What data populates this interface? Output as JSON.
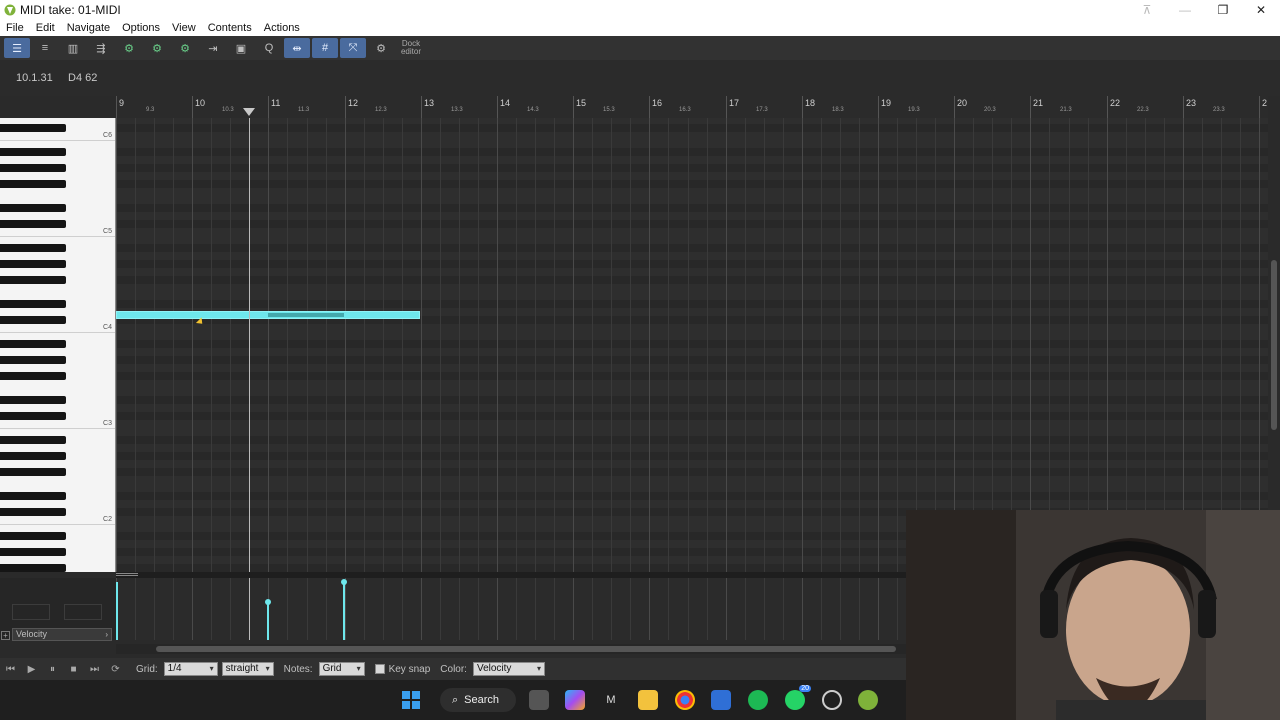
{
  "window": {
    "title": "MIDI take: 01-MIDI"
  },
  "menu": {
    "items": [
      "File",
      "Edit",
      "Navigate",
      "Options",
      "View",
      "Contents",
      "Actions"
    ]
  },
  "toolbar": {
    "dock_label_1": "Dock",
    "dock_label_2": "editor",
    "icons": [
      "midi-editor-icon",
      "list-view-icon",
      "notation-icon",
      "event-properties-icon",
      "step-input-icon",
      "snap-icon",
      "quantize-icon",
      "grid-icon",
      "piano-roll-icon",
      "dock-icon"
    ]
  },
  "info": {
    "position": "10.1.31",
    "note": "D4 62"
  },
  "ruler": {
    "bars": [
      "9",
      "10",
      "11",
      "12",
      "13",
      "14",
      "15",
      "16",
      "17",
      "18",
      "19",
      "20",
      "21",
      "22",
      "23",
      "2"
    ],
    "subs": [
      "9.3",
      "10.3",
      "11.3",
      "12.3",
      "13.3",
      "14.3",
      "15.3",
      "16.3",
      "17.3",
      "18.3",
      "19.3",
      "20.3",
      "21.3",
      "22.3",
      "23.3"
    ]
  },
  "piano": {
    "octave_labels": [
      "C6",
      "C5",
      "C4",
      "C3",
      "C2"
    ]
  },
  "lane": {
    "type": "Velocity"
  },
  "bottom": {
    "grid_label": "Grid:",
    "grid_value": "1/4",
    "swing_value": "straight",
    "notes_label": "Notes:",
    "notes_value": "Grid",
    "keysnap_label": "Key snap",
    "color_label": "Color:",
    "color_value": "Velocity"
  },
  "taskbar": {
    "search_label": "Search",
    "whatsapp_badge": "20"
  },
  "colors": {
    "note": "#6ee7ec",
    "note_selected": "#43a9ad",
    "grid_bg": "#2e2e2e",
    "toolbar_active": "#4a6b9e"
  }
}
